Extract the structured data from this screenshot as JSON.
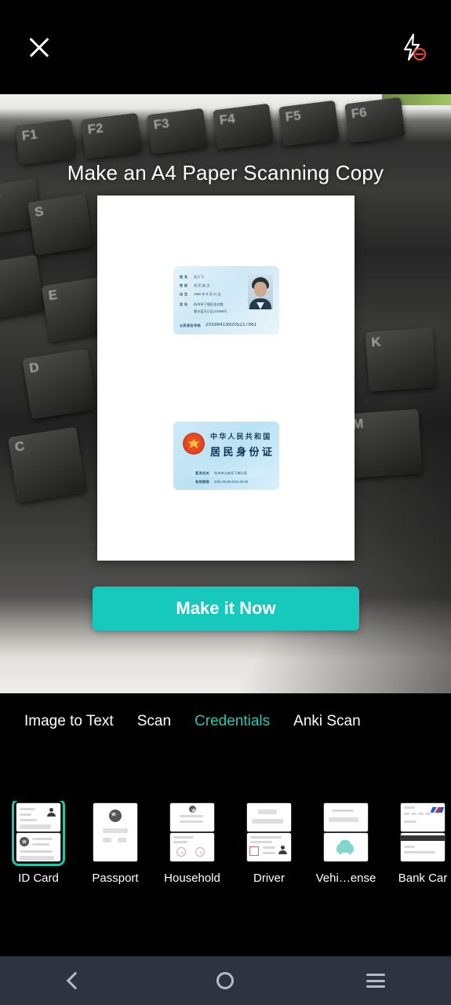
{
  "topbar": {
    "close_icon": "close-icon",
    "flash_icon": "flash-off-icon"
  },
  "preview": {
    "title": "Make an A4 Paper Scanning Copy",
    "sheet": {
      "card_front": {
        "fields": [
          {
            "label": "姓 名",
            "value": "吴小飞"
          },
          {
            "label": "性 别",
            "value": "男    民 族 汉"
          },
          {
            "label": "出 生",
            "value": "1992 年 5 月 21 日"
          },
          {
            "label": "住 址",
            "value": "杭州市下城区金对路"
          },
          {
            "label": "",
            "value": "碧水蓝天小区10-666号"
          }
        ],
        "id_label": "公民身份号码",
        "id_number": "203984199205217961"
      },
      "card_back": {
        "country": "中华人民共和国",
        "doc_type": "居民身份证",
        "issuer_label": "签发机关",
        "issuer_value": "杭州市公安局下城分局",
        "validity_label": "有效期限",
        "validity_value": "2011.09.08-2021.09.08"
      }
    }
  },
  "cta": {
    "label": "Make it Now"
  },
  "tabs": [
    {
      "label": "Image to Text",
      "active": false
    },
    {
      "label": "Scan",
      "active": false
    },
    {
      "label": "Credentials",
      "active": true
    },
    {
      "label": "Anki Scan",
      "active": false
    }
  ],
  "card_types": [
    {
      "label": "ID Card",
      "selected": true
    },
    {
      "label": "Passport",
      "selected": false
    },
    {
      "label": "Household",
      "selected": false
    },
    {
      "label": "Driver",
      "selected": false
    },
    {
      "label": "Vehi…ense",
      "selected": false
    },
    {
      "label": "Bank Car",
      "selected": false
    }
  ],
  "navbar": {
    "back": "back-icon",
    "home": "home-icon",
    "recents": "recents-icon"
  },
  "colors": {
    "accent": "#17c8bd",
    "tab_active": "#26c6ae",
    "selection": "#1fc8a9",
    "navbar_bg": "#2d333f",
    "flash_off": "#e0492c"
  }
}
